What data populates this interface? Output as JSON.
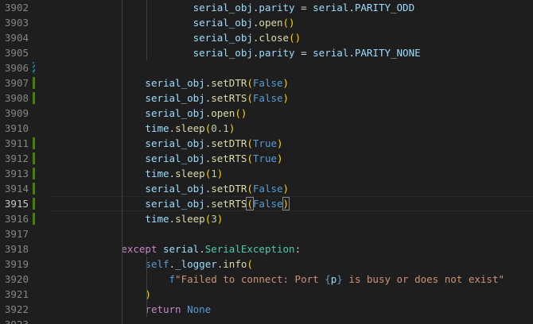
{
  "editor": {
    "active_line": "3915",
    "lines": [
      {
        "num": "3902",
        "diff": "none",
        "tokens": [
          {
            "t": "                        ",
            "c": "p"
          },
          {
            "t": "serial_obj",
            "c": "v"
          },
          {
            "t": ".",
            "c": "p"
          },
          {
            "t": "parity",
            "c": "v"
          },
          {
            "t": " = ",
            "c": "p"
          },
          {
            "t": "serial",
            "c": "v"
          },
          {
            "t": ".",
            "c": "p"
          },
          {
            "t": "PARITY_ODD",
            "c": "v"
          }
        ]
      },
      {
        "num": "3903",
        "diff": "none",
        "tokens": [
          {
            "t": "                        ",
            "c": "p"
          },
          {
            "t": "serial_obj",
            "c": "v"
          },
          {
            "t": ".",
            "c": "p"
          },
          {
            "t": "open",
            "c": "f"
          },
          {
            "t": "()",
            "c": "b1"
          }
        ]
      },
      {
        "num": "3904",
        "diff": "none",
        "tokens": [
          {
            "t": "                        ",
            "c": "p"
          },
          {
            "t": "serial_obj",
            "c": "v"
          },
          {
            "t": ".",
            "c": "p"
          },
          {
            "t": "close",
            "c": "f"
          },
          {
            "t": "()",
            "c": "b1"
          }
        ]
      },
      {
        "num": "3905",
        "diff": "none",
        "tokens": [
          {
            "t": "                        ",
            "c": "p"
          },
          {
            "t": "serial_obj",
            "c": "v"
          },
          {
            "t": ".",
            "c": "p"
          },
          {
            "t": "parity",
            "c": "v"
          },
          {
            "t": " = ",
            "c": "p"
          },
          {
            "t": "serial",
            "c": "v"
          },
          {
            "t": ".",
            "c": "p"
          },
          {
            "t": "PARITY_NONE",
            "c": "v"
          }
        ]
      },
      {
        "num": "3906",
        "diff": "mod-striped",
        "tokens": []
      },
      {
        "num": "3907",
        "diff": "add",
        "tokens": [
          {
            "t": "                ",
            "c": "p"
          },
          {
            "t": "serial_obj",
            "c": "v"
          },
          {
            "t": ".",
            "c": "p"
          },
          {
            "t": "setDTR",
            "c": "f"
          },
          {
            "t": "(",
            "c": "b1"
          },
          {
            "t": "False",
            "c": "k"
          },
          {
            "t": ")",
            "c": "b1"
          }
        ]
      },
      {
        "num": "3908",
        "diff": "add",
        "tokens": [
          {
            "t": "                ",
            "c": "p"
          },
          {
            "t": "serial_obj",
            "c": "v"
          },
          {
            "t": ".",
            "c": "p"
          },
          {
            "t": "setRTS",
            "c": "f"
          },
          {
            "t": "(",
            "c": "b1"
          },
          {
            "t": "False",
            "c": "k"
          },
          {
            "t": ")",
            "c": "b1"
          }
        ]
      },
      {
        "num": "3909",
        "diff": "none",
        "tokens": [
          {
            "t": "                ",
            "c": "p"
          },
          {
            "t": "serial_obj",
            "c": "v"
          },
          {
            "t": ".",
            "c": "p"
          },
          {
            "t": "open",
            "c": "f"
          },
          {
            "t": "()",
            "c": "b1"
          }
        ]
      },
      {
        "num": "3910",
        "diff": "none",
        "tokens": [
          {
            "t": "                ",
            "c": "p"
          },
          {
            "t": "time",
            "c": "v"
          },
          {
            "t": ".",
            "c": "p"
          },
          {
            "t": "sleep",
            "c": "f"
          },
          {
            "t": "(",
            "c": "b1"
          },
          {
            "t": "0.1",
            "c": "n"
          },
          {
            "t": ")",
            "c": "b1"
          }
        ]
      },
      {
        "num": "3911",
        "diff": "add",
        "tokens": [
          {
            "t": "                ",
            "c": "p"
          },
          {
            "t": "serial_obj",
            "c": "v"
          },
          {
            "t": ".",
            "c": "p"
          },
          {
            "t": "setDTR",
            "c": "f"
          },
          {
            "t": "(",
            "c": "b1"
          },
          {
            "t": "True",
            "c": "k"
          },
          {
            "t": ")",
            "c": "b1"
          }
        ]
      },
      {
        "num": "3912",
        "diff": "add",
        "tokens": [
          {
            "t": "                ",
            "c": "p"
          },
          {
            "t": "serial_obj",
            "c": "v"
          },
          {
            "t": ".",
            "c": "p"
          },
          {
            "t": "setRTS",
            "c": "f"
          },
          {
            "t": "(",
            "c": "b1"
          },
          {
            "t": "True",
            "c": "k"
          },
          {
            "t": ")",
            "c": "b1"
          }
        ]
      },
      {
        "num": "3913",
        "diff": "add",
        "tokens": [
          {
            "t": "                ",
            "c": "p"
          },
          {
            "t": "time",
            "c": "v"
          },
          {
            "t": ".",
            "c": "p"
          },
          {
            "t": "sleep",
            "c": "f"
          },
          {
            "t": "(",
            "c": "b1"
          },
          {
            "t": "1",
            "c": "n"
          },
          {
            "t": ")",
            "c": "b1"
          }
        ]
      },
      {
        "num": "3914",
        "diff": "add",
        "tokens": [
          {
            "t": "                ",
            "c": "p"
          },
          {
            "t": "serial_obj",
            "c": "v"
          },
          {
            "t": ".",
            "c": "p"
          },
          {
            "t": "setDTR",
            "c": "f"
          },
          {
            "t": "(",
            "c": "b1"
          },
          {
            "t": "False",
            "c": "k"
          },
          {
            "t": ")",
            "c": "b1"
          }
        ]
      },
      {
        "num": "3915",
        "diff": "add",
        "tokens": [
          {
            "t": "                ",
            "c": "p"
          },
          {
            "t": "serial_obj",
            "c": "v"
          },
          {
            "t": ".",
            "c": "p"
          },
          {
            "t": "setRTS",
            "c": "f"
          },
          {
            "t": "(",
            "c": "b1 bracket-match"
          },
          {
            "t": "False",
            "c": "k"
          },
          {
            "t": ")",
            "c": "b1 bracket-match"
          }
        ]
      },
      {
        "num": "3916",
        "diff": "add",
        "tokens": [
          {
            "t": "                ",
            "c": "p"
          },
          {
            "t": "time",
            "c": "v"
          },
          {
            "t": ".",
            "c": "p"
          },
          {
            "t": "sleep",
            "c": "f"
          },
          {
            "t": "(",
            "c": "b1"
          },
          {
            "t": "3",
            "c": "n"
          },
          {
            "t": ")",
            "c": "b1"
          }
        ]
      },
      {
        "num": "3917",
        "diff": "none",
        "tokens": []
      },
      {
        "num": "3918",
        "diff": "none",
        "tokens": [
          {
            "t": "            ",
            "c": "p"
          },
          {
            "t": "except",
            "c": "kc"
          },
          {
            "t": " ",
            "c": "p"
          },
          {
            "t": "serial",
            "c": "v"
          },
          {
            "t": ".",
            "c": "p"
          },
          {
            "t": "SerialException",
            "c": "c"
          },
          {
            "t": ":",
            "c": "p"
          }
        ]
      },
      {
        "num": "3919",
        "diff": "none",
        "tokens": [
          {
            "t": "                ",
            "c": "p"
          },
          {
            "t": "self",
            "c": "k"
          },
          {
            "t": ".",
            "c": "p"
          },
          {
            "t": "_logger",
            "c": "v"
          },
          {
            "t": ".",
            "c": "p"
          },
          {
            "t": "info",
            "c": "f"
          },
          {
            "t": "(",
            "c": "b1"
          }
        ]
      },
      {
        "num": "3920",
        "diff": "none",
        "tokens": [
          {
            "t": "                    ",
            "c": "p"
          },
          {
            "t": "f",
            "c": "k"
          },
          {
            "t": "\"Failed to connect: Port ",
            "c": "s"
          },
          {
            "t": "{",
            "c": "k"
          },
          {
            "t": "p",
            "c": "v"
          },
          {
            "t": "}",
            "c": "k"
          },
          {
            "t": " is busy or does not exist\"",
            "c": "s"
          }
        ]
      },
      {
        "num": "3921",
        "diff": "none",
        "tokens": [
          {
            "t": "                ",
            "c": "p"
          },
          {
            "t": ")",
            "c": "b1"
          }
        ]
      },
      {
        "num": "3922",
        "diff": "none",
        "tokens": [
          {
            "t": "                ",
            "c": "p"
          },
          {
            "t": "return",
            "c": "kc"
          },
          {
            "t": " ",
            "c": "p"
          },
          {
            "t": "None",
            "c": "k"
          }
        ]
      },
      {
        "num": "3923",
        "diff": "none",
        "tokens": []
      }
    ]
  }
}
